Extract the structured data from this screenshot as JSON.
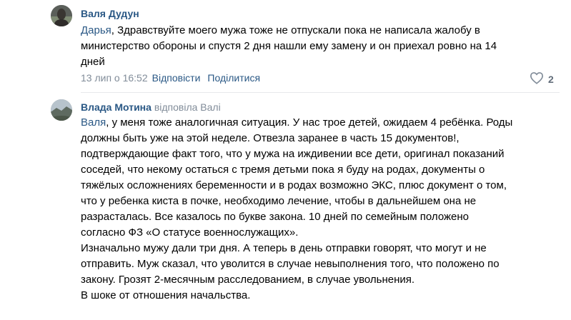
{
  "comments": [
    {
      "author": "Валя Дудун",
      "mention": "Дарья",
      "text": ", Здравствуйте моего мужа тоже не отпускали пока не написала жалобу в\nминистерство обороны и спустя 2 дня нашли ему замену и он приехал ровно на 14\nдней",
      "timestamp": "13 лип о 16:52",
      "reply_label": "Відповісти",
      "share_label": "Поділитися",
      "likes": "2"
    },
    {
      "author": "Влада Мотина",
      "replied_to": "відповіла Валі",
      "mention": "Валя",
      "text": ", у меня тоже аналогичная ситуация. У нас трое детей, ожидаем 4 ребёнка. Роды\nдолжны быть уже на этой неделе. Отвезла заранее в часть 15 документов!,\nподтверждающие факт того, что у мужа на иждивении все дети, оригинал показаний\nсоседей, что некому остаться с тремя детьми пока я буду на родах, документы о\nтяжёлых осложнениях беременности и в родах возможно ЭКС, плюс документ о том,\nчто у ребенка киста в почке, необходимо лечение, чтобы в дальнейшем она не\nразрасталась. Все казалось по букве закона. 10 дней по семейным положено\nсогласно ФЗ «О статусе военнослужащих».\nИзначально мужу дали три дня. А теперь в день отправки говорят, что могут и не\nотправить. Муж сказал, что уволится в случае невыполнения того, что положено по\nзакону. Грозят 2-месячным расследованием, в случае увольнения.\nВ шоке от отношения начальства."
    }
  ],
  "icons": {
    "like": "heart-outline-icon"
  },
  "colors": {
    "link": "#2a5885",
    "meta": "#818c99",
    "divider": "#e7e8ec"
  }
}
